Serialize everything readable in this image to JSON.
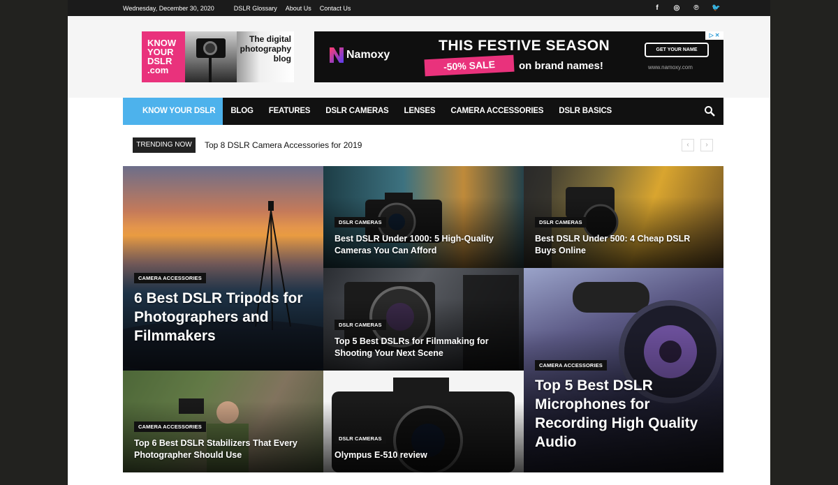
{
  "topbar": {
    "date": "Wednesday, December 30, 2020",
    "links": [
      "DSLR Glossary",
      "About Us",
      "Contact Us"
    ],
    "social": [
      {
        "icon": "facebook-icon",
        "glyph": "f"
      },
      {
        "icon": "instagram-icon",
        "glyph": "◎"
      },
      {
        "icon": "pinterest-icon",
        "glyph": "℗"
      },
      {
        "icon": "twitter-icon",
        "glyph": "🐦"
      }
    ]
  },
  "logo": {
    "left_text": "KNOW YOUR DSLR .com",
    "tagline": "The digital photography blog"
  },
  "ad": {
    "brand": "Namoxy",
    "headline": "THIS FESTIVE SEASON",
    "sale": "-50% SALE",
    "subline": "on brand names!",
    "cta": "GET YOUR NAME",
    "url": "www.namoxy.com"
  },
  "nav": {
    "items": [
      "KNOW YOUR DSLR",
      "BLOG",
      "FEATURES",
      "DSLR CAMERAS",
      "LENSES",
      "CAMERA ACCESSORIES",
      "DSLR BASICS"
    ]
  },
  "trending": {
    "label": "TRENDING NOW",
    "title": "Top 8 DSLR Camera Accessories for 2019",
    "prev": "‹",
    "next": "›"
  },
  "tiles": [
    {
      "category": "CAMERA ACCESSORIES",
      "title": "6 Best DSLR Tripods for Photographers and Filmmakers"
    },
    {
      "category": "DSLR CAMERAS",
      "title": "Best DSLR Under 1000: 5 High-Quality Cameras You Can Afford"
    },
    {
      "category": "DSLR CAMERAS",
      "title": "Best DSLR Under 500: 4 Cheap DSLR Buys Online"
    },
    {
      "category": "DSLR CAMERAS",
      "title": "Top 5 Best DSLRs for Filmmaking for Shooting Your Next Scene"
    },
    {
      "category": "CAMERA ACCESSORIES",
      "title": "Top 5 Best DSLR Microphones for Recording High Quality Audio"
    },
    {
      "category": "CAMERA ACCESSORIES",
      "title": "Top 6 Best DSLR Stabilizers That Every Photographer Should Use"
    },
    {
      "category": "DSLR CAMERAS",
      "title": "Olympus E-510 review"
    }
  ],
  "colors": {
    "accent": "#4db2ec",
    "nav_bg": "#111111",
    "logo_pink": "#e9327c"
  }
}
